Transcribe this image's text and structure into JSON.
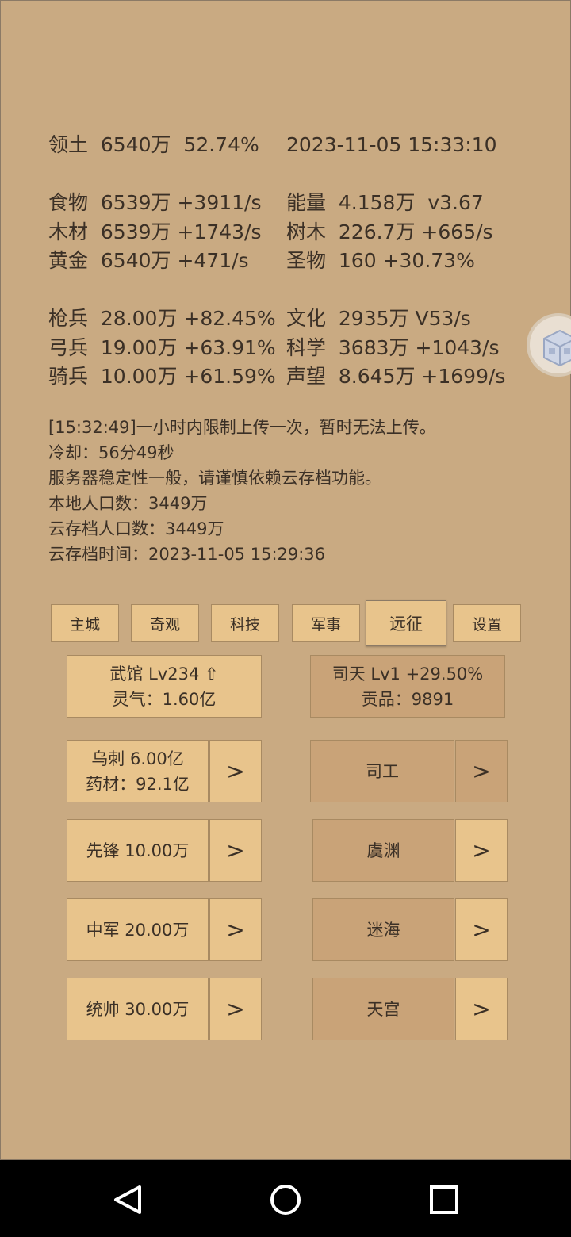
{
  "stats": {
    "territory": "领土  6540万  52.74%",
    "datetime": "2023-11-05 15:33:10",
    "food": "食物  6539万 +3911/s",
    "energy": "能量  4.158万  v3.67",
    "wood": "木材  6539万 +1743/s",
    "trees": "树木  226.7万 +665/s",
    "gold": "黄金  6540万 +471/s",
    "relics": "圣物  160 +30.73%",
    "spearmen": "枪兵  28.00万 +82.45%",
    "culture": "文化  2935万 V53/s",
    "archers": "弓兵  19.00万 +63.91%",
    "science": "科学  3683万 +1043/s",
    "cavalry": "骑兵  10.00万 +61.59%",
    "prestige": "声望  8.645万 +1699/s"
  },
  "log": {
    "line1": "[15:32:49]一小时内限制上传一次，暂时无法上传。",
    "line2": "冷却：56分49秒",
    "line3": "服务器稳定性一般，请谨慎依赖云存档功能。",
    "line4": "本地人口数：3449万",
    "line5": "云存档人口数：3449万",
    "line6": "云存档时间：2023-11-05 15:29:36"
  },
  "tabs": {
    "main_city": "主城",
    "wonders": "奇观",
    "tech": "科技",
    "military": "军事",
    "expedition": "远征",
    "settings": "设置"
  },
  "panels": {
    "wuguan_line1": "武馆 Lv234 ⇧",
    "wuguan_line2": "灵气：1.60亿",
    "sitian_line1": "司天 Lv1 +29.50%",
    "sitian_line2": "贡品：9891",
    "wuci_line1": "乌刺  6.00亿",
    "wuci_line2": "药材：92.1亿",
    "vanguard": "先锋  10.00万",
    "center_army": "中军  20.00万",
    "commander": "统帅  30.00万",
    "sigong": "司工",
    "yuyuan": "虞渊",
    "mihai": "迷海",
    "tiangong": "天宫",
    "arrow": ">"
  },
  "colors": {
    "background": "#c9aa82",
    "button_light": "#e8c48c",
    "button_dark": "#c9a378",
    "text": "#3b3026"
  },
  "icons": {
    "floating": "cube-icon",
    "nav": [
      "back-icon",
      "home-icon",
      "recents-icon"
    ]
  }
}
